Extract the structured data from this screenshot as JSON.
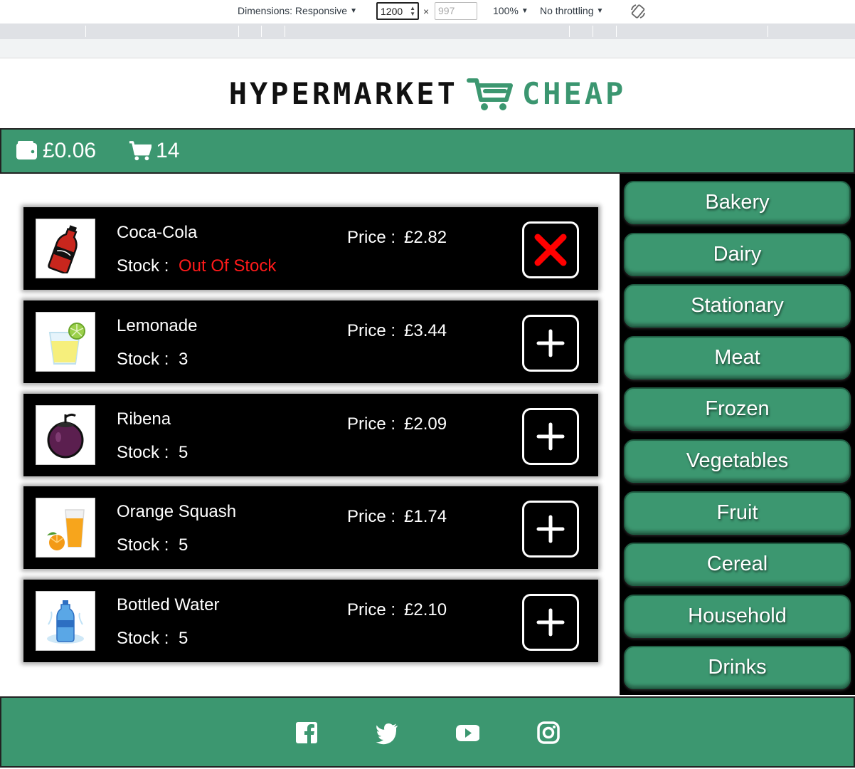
{
  "devtools": {
    "dimensions_label": "Dimensions: Responsive",
    "width_value": "1200",
    "height_placeholder": "997",
    "times": "×",
    "zoom": "100%",
    "throttling": "No throttling"
  },
  "logo": {
    "left": "HYPERMARKET",
    "right": "CHEAP"
  },
  "topbar": {
    "balance": "£0.06",
    "cart_count": "14"
  },
  "products": [
    {
      "name": "Coca-Cola",
      "stock_label": "Stock :",
      "stock": "Out Of Stock",
      "price_label": "Price :",
      "price": "£2.82",
      "in_stock": false
    },
    {
      "name": "Lemonade",
      "stock_label": "Stock :",
      "stock": "3",
      "price_label": "Price :",
      "price": "£3.44",
      "in_stock": true
    },
    {
      "name": "Ribena",
      "stock_label": "Stock :",
      "stock": "5",
      "price_label": "Price :",
      "price": "£2.09",
      "in_stock": true
    },
    {
      "name": "Orange Squash",
      "stock_label": "Stock :",
      "stock": "5",
      "price_label": "Price :",
      "price": "£1.74",
      "in_stock": true
    },
    {
      "name": "Bottled Water",
      "stock_label": "Stock :",
      "stock": "5",
      "price_label": "Price :",
      "price": "£2.10",
      "in_stock": true
    }
  ],
  "categories": [
    "Bakery",
    "Dairy",
    "Stationary",
    "Meat",
    "Frozen",
    "Vegetables",
    "Fruit",
    "Cereal",
    "Household",
    "Drinks"
  ],
  "colors": {
    "brand_green": "#3c9770",
    "out_of_stock_red": "#ff1a1a",
    "remove_x_red": "#ff0000"
  },
  "footer_icons": [
    "facebook-icon",
    "twitter-icon",
    "youtube-icon",
    "instagram-icon"
  ]
}
